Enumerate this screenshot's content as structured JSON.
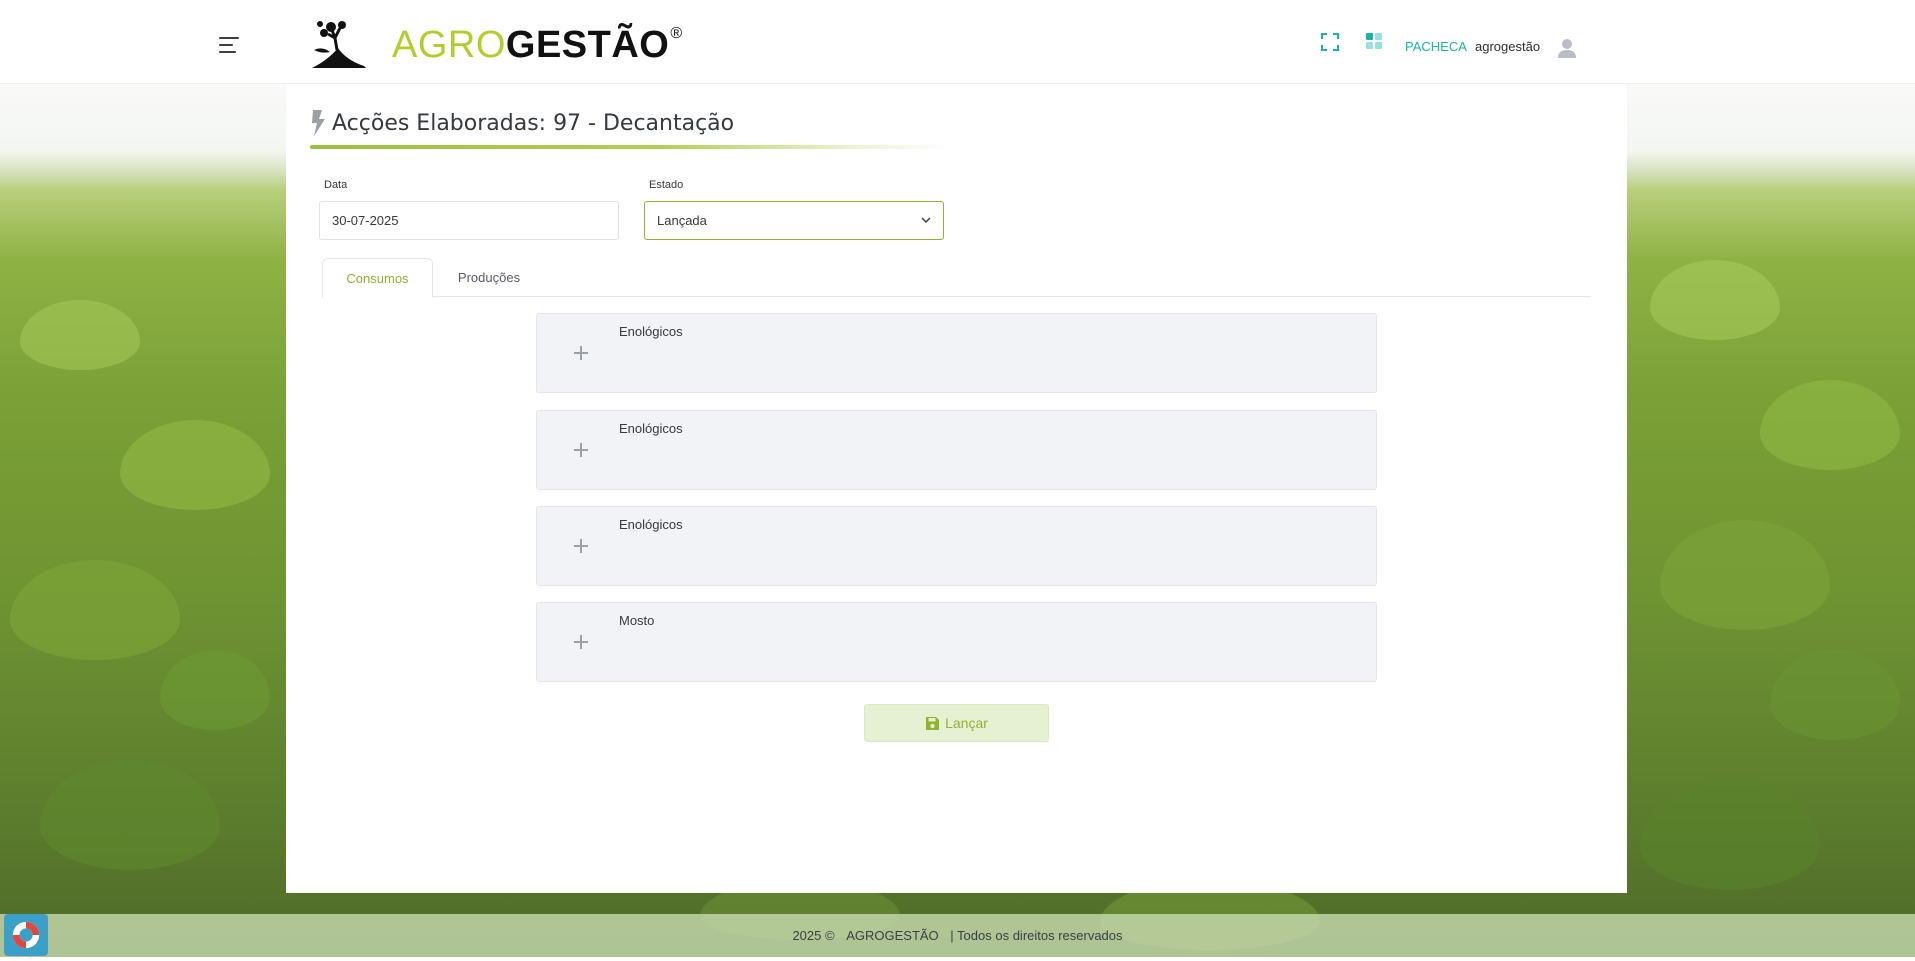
{
  "header": {
    "logo": {
      "agro": "AGRO",
      "gestao": "GESTÃO",
      "reg": "®"
    },
    "company": "PACHECA",
    "username": "agrogestão"
  },
  "page": {
    "title": "Acções Elaboradas: 97 - Decantação"
  },
  "form": {
    "data_label": "Data",
    "data_value": "30-07-2025",
    "estado_label": "Estado",
    "estado_value": "Lançada"
  },
  "tabs": [
    {
      "label": "Consumos",
      "active": true
    },
    {
      "label": "Produções",
      "active": false
    }
  ],
  "accordion": [
    {
      "label": "Enológicos"
    },
    {
      "label": "Enológicos"
    },
    {
      "label": "Enológicos"
    },
    {
      "label": "Mosto"
    }
  ],
  "actions": {
    "launch_label": "Lançar"
  },
  "footer": {
    "year": "2025 ©",
    "brand": "AGROGESTÃO",
    "rights": "| Todos os direitos reservados"
  },
  "colors": {
    "accent": "#8fb32d",
    "brand_agro": "#b5cc2b",
    "teal": "#1ab3a8",
    "accordion_bg": "#f1f3f6",
    "help_button": "#3c9fc8"
  },
  "icons": [
    "menu-icon",
    "logo-tree-icon",
    "fullscreen-icon",
    "apps-icon",
    "user-icon",
    "bolt-icon",
    "chevron-down-icon",
    "plus-icon",
    "save-icon",
    "lifebuoy-icon"
  ]
}
